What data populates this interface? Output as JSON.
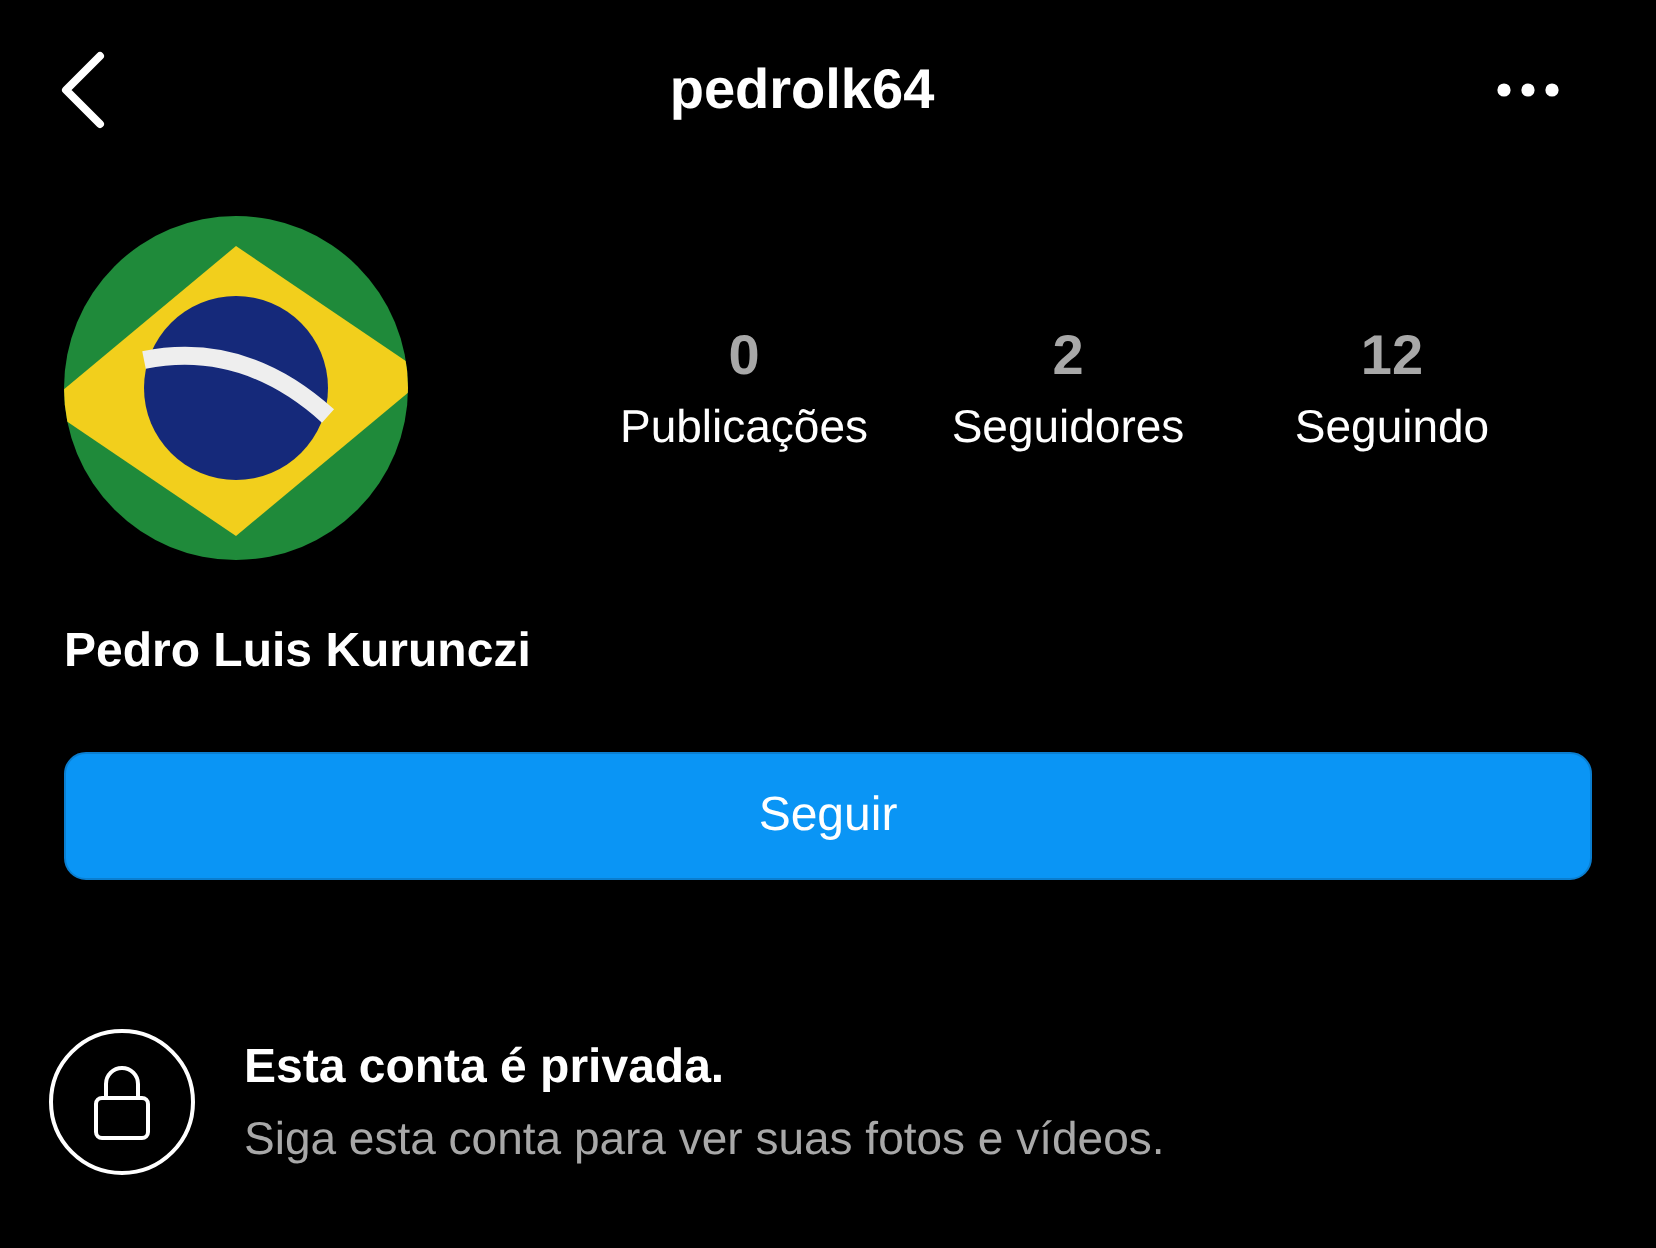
{
  "header": {
    "username": "pedrolk64"
  },
  "profile": {
    "name": "Pedro Luis Kurunczi"
  },
  "stats": [
    {
      "count": "0",
      "label": "Publicações"
    },
    {
      "count": "2",
      "label": "Seguidores"
    },
    {
      "count": "12",
      "label": "Seguindo"
    }
  ],
  "follow_button": {
    "label": "Seguir"
  },
  "private_notice": {
    "title": "Esta conta é privada.",
    "text": "Siga esta conta para ver suas fotos e vídeos."
  }
}
